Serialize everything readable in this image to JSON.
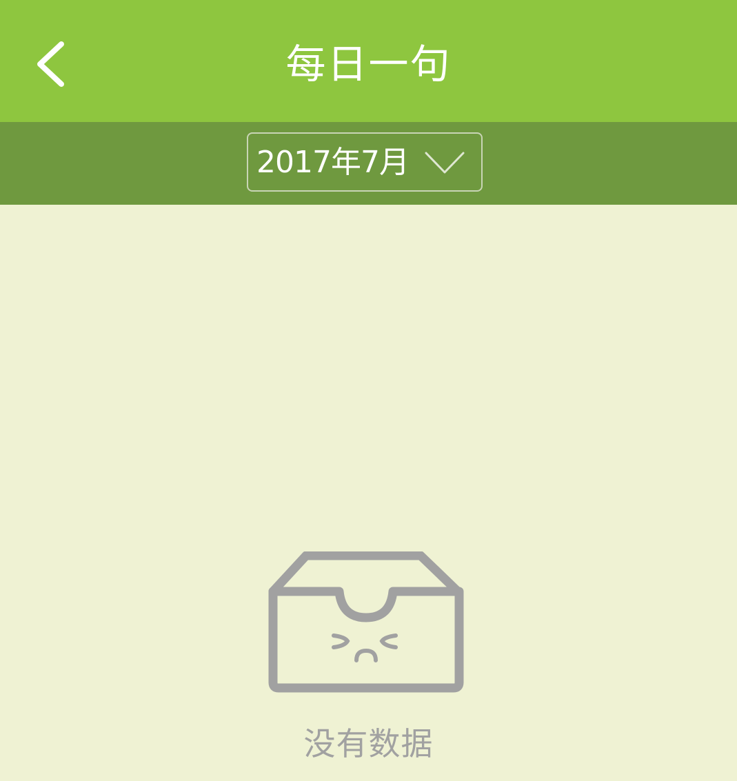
{
  "header": {
    "title": "每日一句",
    "back_icon": "chevron-left-icon"
  },
  "date_picker": {
    "selected": "2017年7月",
    "dropdown_icon": "chevron-down-icon"
  },
  "empty_state": {
    "icon": "empty-box-icon",
    "message": "没有数据"
  },
  "colors": {
    "header_bg": "#8ec63f",
    "subbar_bg": "#6f993f",
    "page_bg": "#eff2d3",
    "icon_gray": "#a1a1a1"
  }
}
